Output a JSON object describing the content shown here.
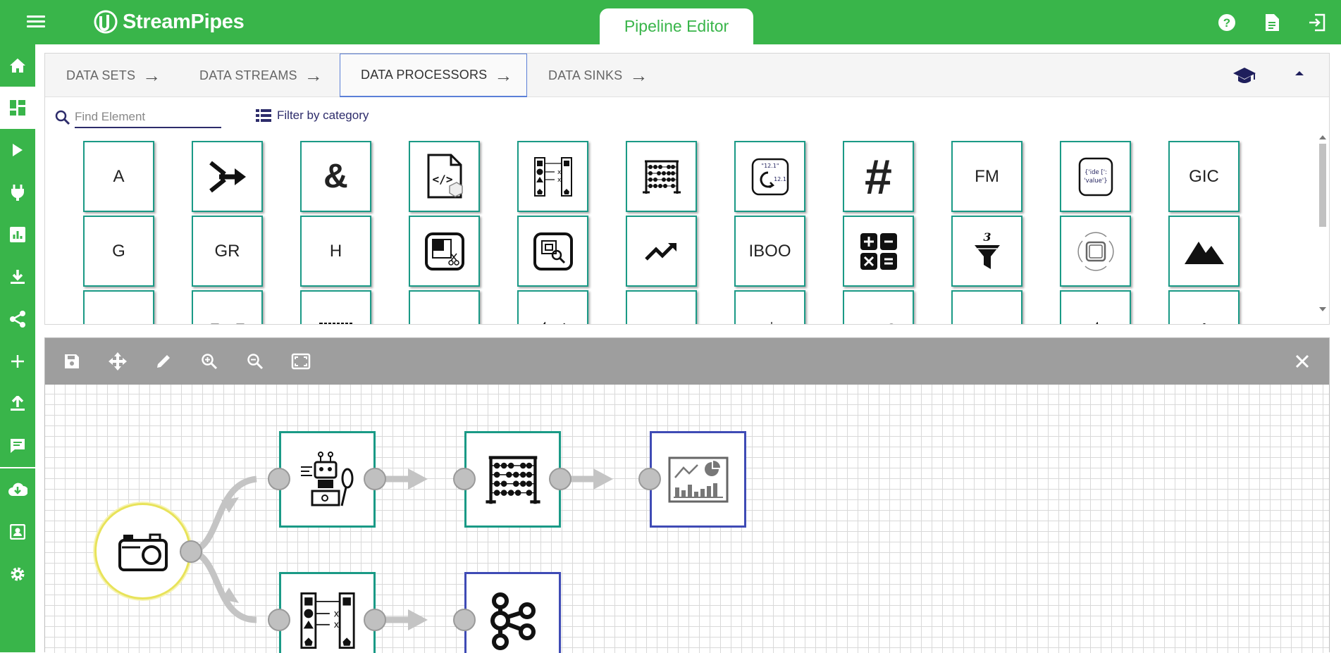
{
  "app": {
    "name": "StreamPipes",
    "active_view": "Pipeline Editor"
  },
  "header": {
    "icons": [
      "help-icon",
      "documentation-icon",
      "logout-icon"
    ]
  },
  "sidebar": {
    "items": [
      "home-icon",
      "dashboard-icon",
      "pipelines-icon",
      "connect-icon",
      "data-explorer-icon",
      "install-icon",
      "share-icon",
      "add-icon",
      "upload-icon",
      "notifications-icon",
      "download-icon",
      "account-icon",
      "settings-icon"
    ],
    "active_index": 1
  },
  "palette": {
    "tabs": [
      {
        "label": "DATA SETS"
      },
      {
        "label": "DATA STREAMS"
      },
      {
        "label": "DATA PROCESSORS"
      },
      {
        "label": "DATA SINKS"
      }
    ],
    "active_tab": 2,
    "search": {
      "placeholder": "Find Element",
      "value": ""
    },
    "filter_label": "Filter by category",
    "row1": [
      "A",
      "merge-icon",
      "&",
      "code-file-icon",
      "field-mapper-icon",
      "abacus-icon",
      "number-format-icon",
      "#",
      "FM",
      "json-icon",
      "GIC"
    ],
    "row2": [
      "G",
      "GR",
      "H",
      "image-cropper-icon",
      "image-enricher-icon",
      "trend-icon",
      "IBOO",
      "calculator-icon",
      "top-filter-icon",
      "vibration-icon",
      "peak-icon"
    ]
  },
  "editor": {
    "toolbar": [
      "save-icon",
      "move-icon",
      "edit-icon",
      "zoom-in-icon",
      "zoom-out-icon",
      "fit-icon",
      "close-icon"
    ],
    "nodes": [
      "camera-source",
      "robot-processor",
      "abacus-processor",
      "dashboard-sink",
      "mapper-processor",
      "kafka-sink"
    ]
  },
  "colors": {
    "brand_green": "#39b54a",
    "processor_border": "#1a9a86",
    "sink_border": "#3f4bb5",
    "source_border": "#e8e35a",
    "toolbar_gray": "#9e9e9e",
    "accent_navy": "#2d2c6b"
  }
}
